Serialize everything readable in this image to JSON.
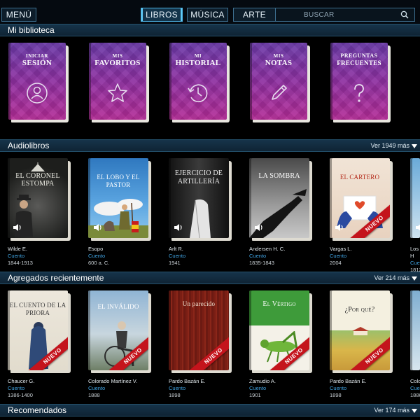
{
  "nav": {
    "menu": "MENÚ",
    "libros": "LIBROS",
    "musica": "MÚSICA",
    "arte": "ARTE",
    "search_placeholder": "BUSCAR"
  },
  "biblioteca": {
    "title": "Mi biblioteca",
    "items": [
      {
        "line1": "INICIAR",
        "line2": "SESIÓN",
        "icon": "user-icon"
      },
      {
        "line1": "MIS",
        "line2": "FAVORITOS",
        "icon": "star-icon"
      },
      {
        "line1": "MI",
        "line2": "HISTORIAL",
        "icon": "history-clock-icon"
      },
      {
        "line1": "MIS",
        "line2": "NOTAS",
        "icon": "pencil-icon"
      },
      {
        "line1": "PREGUNTAS",
        "line2": "FRECUENTES",
        "icon": "question-icon"
      }
    ]
  },
  "audiolibros": {
    "title": "Audiolibros",
    "more": "Ver 1949 más",
    "books": [
      {
        "title": "El Coronel Estompa",
        "author": "Wilde E.",
        "genre": "Cuento",
        "year": "1844-1913"
      },
      {
        "title": "El Lobo y el Pastor",
        "author": "Esopo",
        "genre": "Cuento",
        "year": "600 a. C."
      },
      {
        "title": "Ejercicio de Artillería",
        "author": "Arlt R.",
        "genre": "Cuento",
        "year": "1941"
      },
      {
        "title": "La Sombra",
        "author": "Andersen H. C.",
        "genre": "Cuento",
        "year": "1835-1843"
      },
      {
        "title": "El Cartero",
        "author": "Vargas L.",
        "genre": "Cuento",
        "year": "2004",
        "badge": "NUEVO"
      },
      {
        "title": "",
        "author": "Los H",
        "genre": "Cuen",
        "year": "1812"
      }
    ]
  },
  "recientes": {
    "title": "Agregados recientemente",
    "more": "Ver 214 más",
    "books": [
      {
        "title": "El Cuento de la Priora",
        "author": "Chaucer G.",
        "genre": "Cuento",
        "year": "1386-1400",
        "badge": "NUEVO"
      },
      {
        "title": "El Inválido",
        "author": "Colorado Martínez V.",
        "genre": "Cuento",
        "year": "1888",
        "badge": "NUEVO"
      },
      {
        "title": "Un parecido",
        "author": "Pardo Bazán E.",
        "genre": "Cuento",
        "year": "1898",
        "badge": "NUEVO"
      },
      {
        "title": "El Vértigo",
        "author": "Zamudio A.",
        "genre": "Cuento",
        "year": "1901",
        "badge": "NUEVO"
      },
      {
        "title": "¿Por qué?",
        "author": "Pardo Bazán E.",
        "genre": "Cuento",
        "year": "1898",
        "badge": "NUEVO"
      },
      {
        "title": "",
        "author": "Colo",
        "genre": "Cuen",
        "year": "1886"
      }
    ]
  },
  "recomendados": {
    "title": "Recomendados",
    "more": "Ver 174 más"
  },
  "colors": {
    "accent": "#4fb6e8",
    "genre_link": "#3fa2e0",
    "new_badge": "#c4141c",
    "library_cover": "#8e2fa0"
  }
}
